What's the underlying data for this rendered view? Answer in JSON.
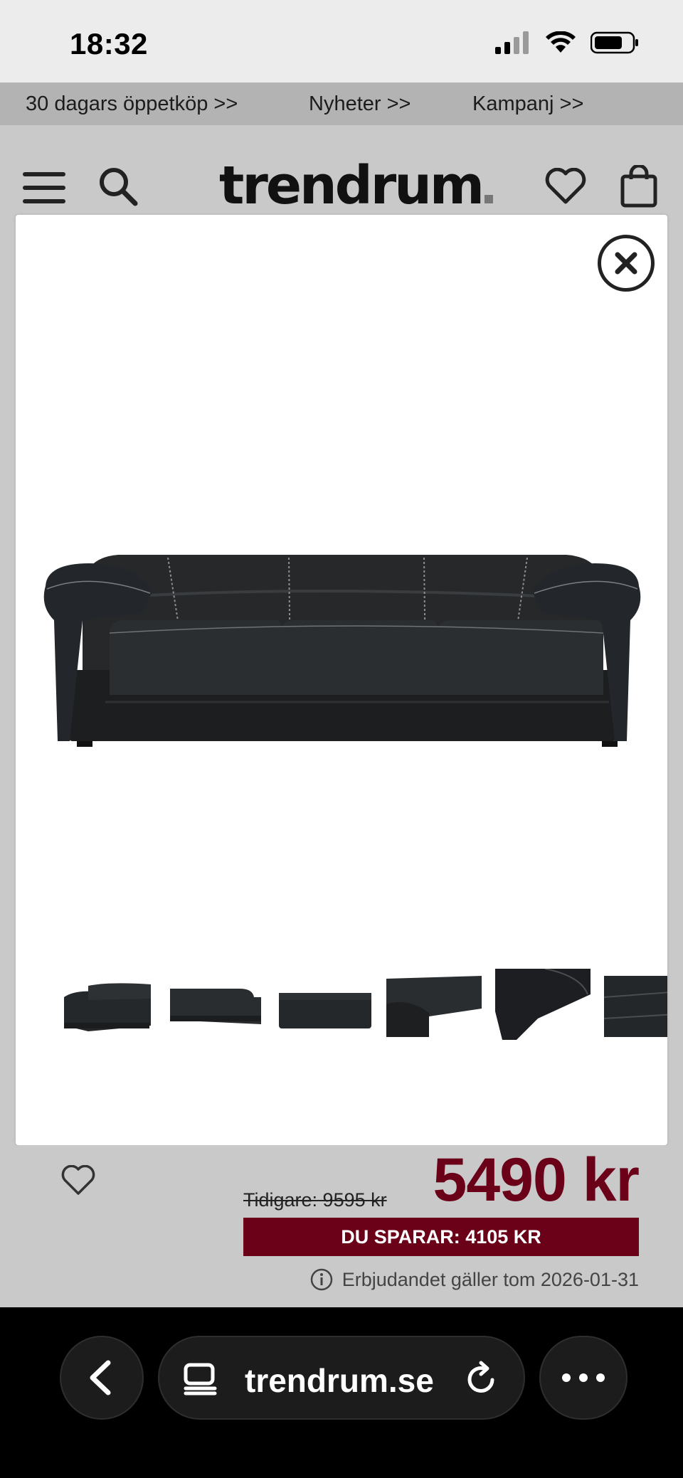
{
  "status": {
    "time": "18:32"
  },
  "promo": {
    "links": [
      "30 dagars öppetköp >>",
      "Nyheter >>",
      "Kampanj >>"
    ]
  },
  "header": {
    "logo": "trendrum",
    "icons": [
      "menu-icon",
      "search-icon",
      "heart-icon",
      "bag-icon"
    ]
  },
  "gallery": {
    "thumbnail_count": 6,
    "product_color": "#1e2022"
  },
  "pricing": {
    "old_price": "Tidigare: 9595 kr",
    "price": "5490 kr",
    "savings": "DU SPARAR: 4105 KR",
    "offer_note": "Erbjudandet gäller tom 2026-01-31",
    "accent_color": "#6b0019"
  },
  "browser": {
    "url": "trendrum.se"
  }
}
